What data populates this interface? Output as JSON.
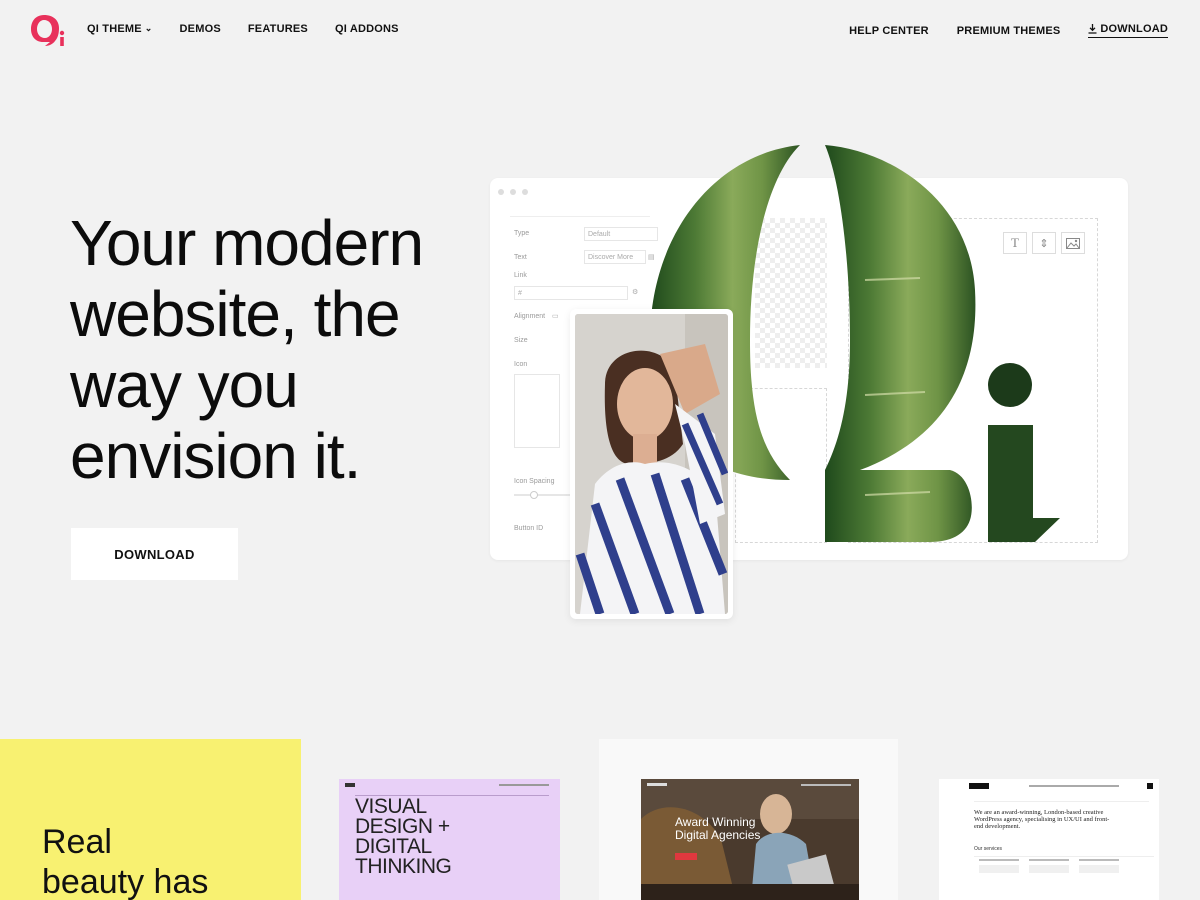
{
  "nav": {
    "left": [
      {
        "label": "QI THEME",
        "dropdown": true
      },
      {
        "label": "DEMOS"
      },
      {
        "label": "FEATURES"
      },
      {
        "label": "QI ADDONS"
      }
    ],
    "right": [
      {
        "label": "HELP CENTER"
      },
      {
        "label": "PREMIUM THEMES"
      },
      {
        "label": "DOWNLOAD",
        "icon": "download-icon"
      }
    ]
  },
  "hero": {
    "title": "Your modern website, the way you envision it.",
    "button": "DOWNLOAD"
  },
  "mockup": {
    "fields": {
      "type_label": "Type",
      "type_value": "Default",
      "text_label": "Text",
      "text_value": "Discover More",
      "link_label": "Link",
      "link_value": "#",
      "alignment_label": "Alignment",
      "size_label": "Size",
      "icon_label": "Icon",
      "icon_spacing_label": "Icon Spacing",
      "button_id_label": "Button ID"
    }
  },
  "bottom": {
    "yellow_text_1": "Real",
    "yellow_text_2": "beauty",
    "yellow_text_3": "has"
  },
  "thumbs": {
    "t1_title": "VISUAL DESIGN + DIGITAL THINKING",
    "t2_title": "Award Winning Digital Agencies",
    "t3_text": "We are an award-winning, London-based creative WordPress agency, specialising in UX/UI and front-end development.",
    "t3_services": "Our services"
  },
  "colors": {
    "background": "#f2f2f2",
    "brand": "#e8315b",
    "yellow": "#f8f171",
    "lavender": "#e8d0f7"
  }
}
